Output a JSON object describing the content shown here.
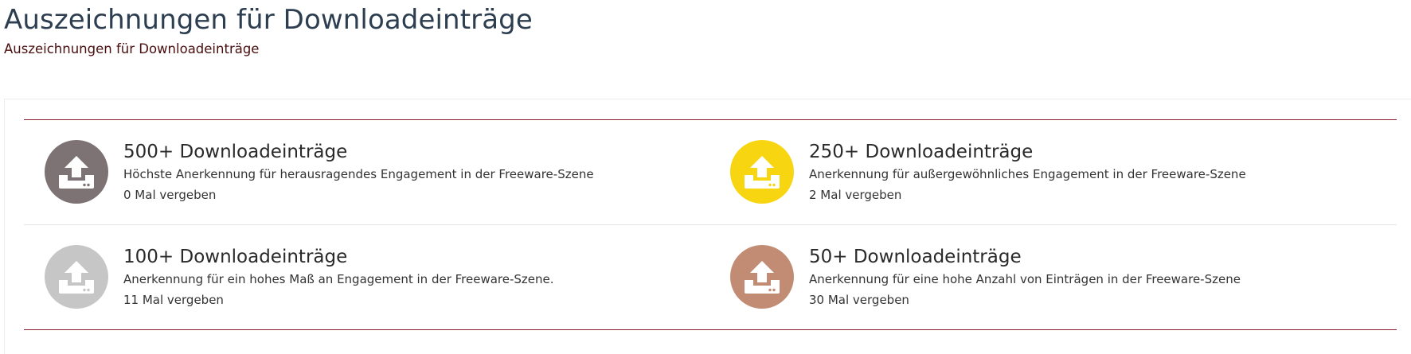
{
  "page": {
    "title": "Auszeichnungen für Downloadeinträge",
    "subtitle": "Auszeichnungen für Downloadeinträge"
  },
  "awards": [
    {
      "name": "500+ Downloadeinträge",
      "description": "Höchste Anerkennung für herausragendes Engagement in der Freeware-Szene",
      "count": "0 Mal vergeben",
      "color": "#7d7274",
      "icon": "upload-icon"
    },
    {
      "name": "250+ Downloadeinträge",
      "description": "Anerkennung für außergewöhnliches Engagement in der Freeware-Szene",
      "count": "2 Mal vergeben",
      "color": "#f8d511",
      "icon": "upload-icon"
    },
    {
      "name": "100+ Downloadeinträge",
      "description": "Anerkennung für ein hohes Maß an Engagement in der Freeware-Szene.",
      "count": "11 Mal vergeben",
      "color": "#c6c6c6",
      "icon": "upload-icon"
    },
    {
      "name": "50+ Downloadeinträge",
      "description": "Anerkennung für eine hohe Anzahl von Einträgen in der Freeware-Szene",
      "count": "30 Mal vergeben",
      "color": "#c28c74",
      "icon": "upload-icon"
    }
  ]
}
